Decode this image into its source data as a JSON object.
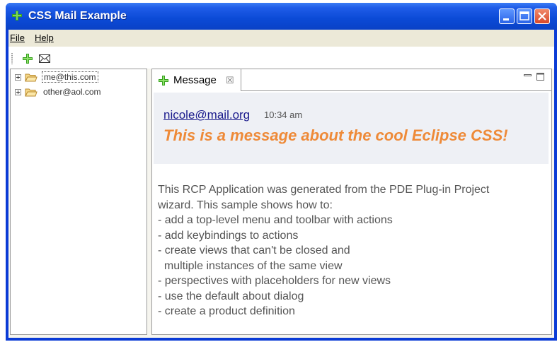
{
  "window": {
    "title": "CSS Mail Example",
    "icons": [
      "plus-icon",
      "minimize-icon",
      "maximize-icon",
      "close-icon"
    ],
    "colors": {
      "titlebar": "#0a41c6",
      "close": "#d8482a",
      "accent_green": "#37a11f"
    }
  },
  "menubar": {
    "file": "File",
    "help": "Help"
  },
  "toolbar": {
    "icons": [
      "add-icon",
      "envelope-icon"
    ]
  },
  "navigator": {
    "items": [
      {
        "label": "me@this.com",
        "icon": "folder-icon",
        "selected": true
      },
      {
        "label": "other@aol.com",
        "icon": "folder-icon",
        "selected": false
      }
    ]
  },
  "editor": {
    "tab": {
      "label": "Message",
      "close_symbol": "☒"
    },
    "message": {
      "sender": "nicole@mail.org",
      "time": "10:34 am",
      "subject": "This is a message about the cool Eclipse CSS!",
      "subject_color": "#ee8a38",
      "body_lines": [
        "This RCP Application was generated from the PDE Plug-in Project",
        "wizard. This sample shows how to:",
        "- add a top-level menu and toolbar with actions",
        "- add keybindings to actions",
        "- create views that can't be closed and",
        "  multiple instances of the same view",
        "- perspectives with placeholders for new views",
        "- use the default about dialog",
        "- create a product definition"
      ]
    }
  }
}
